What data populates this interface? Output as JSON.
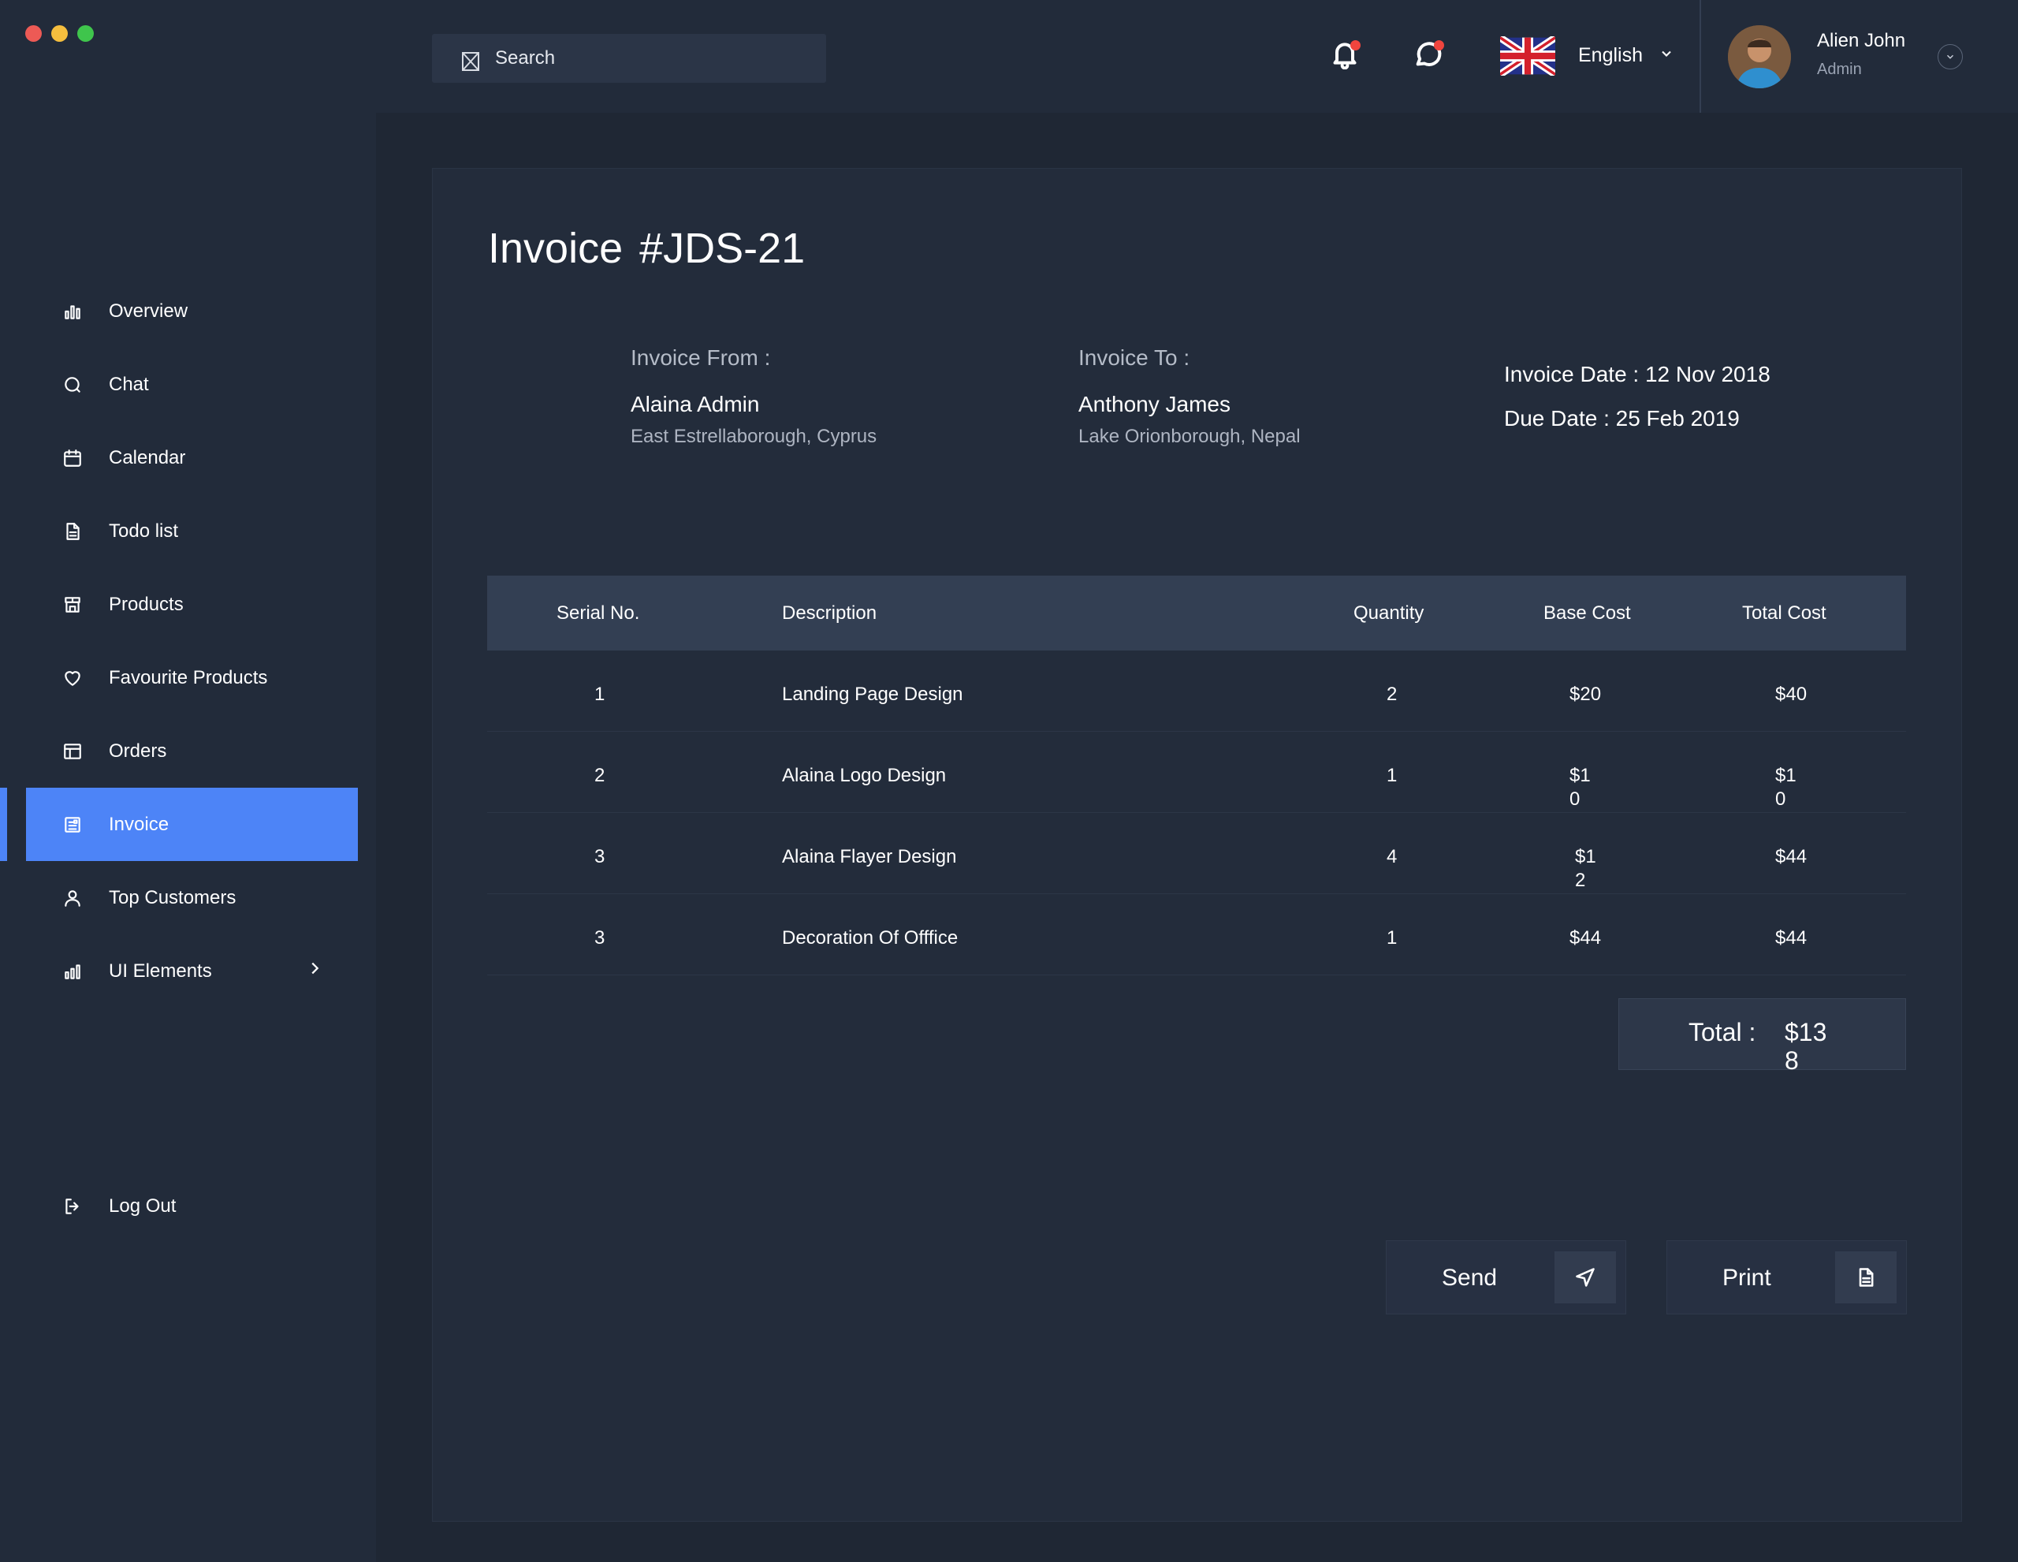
{
  "window": {
    "controls": {
      "close_color": "#ed5a55",
      "minimize_color": "#f5be3e",
      "maximize_color": "#3fc54c"
    }
  },
  "sidebar": {
    "items": [
      {
        "label": "Overview",
        "icon": "bar-chart-icon"
      },
      {
        "label": "Chat",
        "icon": "chat-icon"
      },
      {
        "label": "Calendar",
        "icon": "calendar-icon"
      },
      {
        "label": "Todo list",
        "icon": "document-icon"
      },
      {
        "label": "Products",
        "icon": "store-icon"
      },
      {
        "label": "Favourite Products",
        "icon": "heart-icon"
      },
      {
        "label": "Orders",
        "icon": "layout-icon"
      },
      {
        "label": "Invoice",
        "icon": "invoice-icon",
        "active": true
      },
      {
        "label": "Top Customers",
        "icon": "user-icon"
      },
      {
        "label": "UI Elements",
        "icon": "bar-chart-icon",
        "has_submenu": true
      }
    ],
    "logout": {
      "label": "Log Out",
      "icon": "logout-icon"
    },
    "accent_color": "#4d84f7"
  },
  "header": {
    "search": {
      "placeholder": "Search",
      "icon": "search-icon"
    },
    "notifications": {
      "icon": "bell-icon",
      "has_badge": true
    },
    "messages": {
      "icon": "chat-bubble-icon",
      "has_badge": true
    },
    "language": {
      "flag": "uk-flag",
      "label": "English"
    },
    "user": {
      "name": "Alien John",
      "role": "Admin"
    }
  },
  "invoice": {
    "title": "Invoice  #JDS-21",
    "from": {
      "label": "Invoice From :",
      "name": "Alaina Admin",
      "address": "East Estrellaborough, Cyprus"
    },
    "to": {
      "label": "Invoice To :",
      "name": "Anthony James",
      "address": "Lake Orionborough, Nepal"
    },
    "invoice_date": "Invoice Date : 12 Nov 2018",
    "due_date": "Due Date : 25 Feb 2019",
    "columns": [
      "Serial No.",
      "Description",
      "Quantity",
      "Base Cost",
      "Total Cost"
    ],
    "rows": [
      {
        "serial": "1",
        "description": "Landing Page Design",
        "quantity": "2",
        "base": "$20",
        "total": "$40"
      },
      {
        "serial": "2",
        "description": "Alaina Logo Design",
        "quantity": "1",
        "base": "$10",
        "total": "$10"
      },
      {
        "serial": "3",
        "description": "Alaina Flayer Design",
        "quantity": "4",
        "base": "$12",
        "total": "$44"
      },
      {
        "serial": "3",
        "description": "Decoration Of Offfice",
        "quantity": "1",
        "base": "$44",
        "total": "$44"
      }
    ],
    "total_label": "Total :",
    "total_value": "$138",
    "send_label": "Send",
    "print_label": "Print"
  }
}
